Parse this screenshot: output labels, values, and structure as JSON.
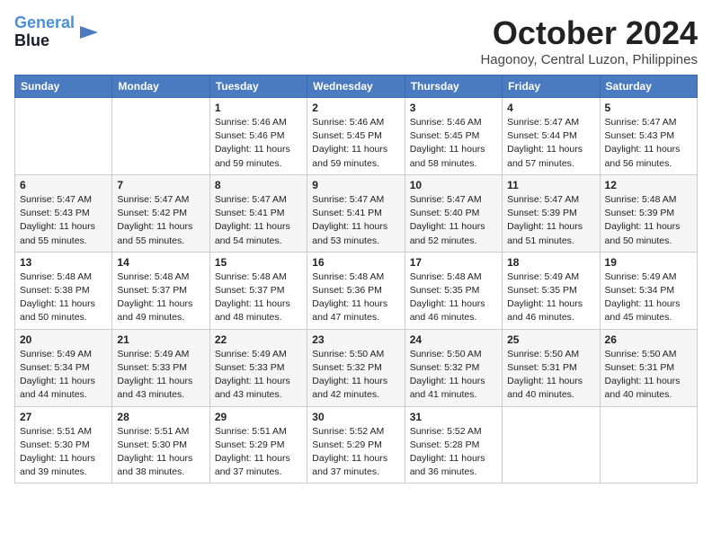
{
  "logo": {
    "line1": "General",
    "line2": "Blue",
    "icon": "▶"
  },
  "title": "October 2024",
  "location": "Hagonoy, Central Luzon, Philippines",
  "days_of_week": [
    "Sunday",
    "Monday",
    "Tuesday",
    "Wednesday",
    "Thursday",
    "Friday",
    "Saturday"
  ],
  "weeks": [
    [
      {
        "day": "",
        "info": ""
      },
      {
        "day": "",
        "info": ""
      },
      {
        "day": "1",
        "info": "Sunrise: 5:46 AM\nSunset: 5:46 PM\nDaylight: 11 hours\nand 59 minutes."
      },
      {
        "day": "2",
        "info": "Sunrise: 5:46 AM\nSunset: 5:45 PM\nDaylight: 11 hours\nand 59 minutes."
      },
      {
        "day": "3",
        "info": "Sunrise: 5:46 AM\nSunset: 5:45 PM\nDaylight: 11 hours\nand 58 minutes."
      },
      {
        "day": "4",
        "info": "Sunrise: 5:47 AM\nSunset: 5:44 PM\nDaylight: 11 hours\nand 57 minutes."
      },
      {
        "day": "5",
        "info": "Sunrise: 5:47 AM\nSunset: 5:43 PM\nDaylight: 11 hours\nand 56 minutes."
      }
    ],
    [
      {
        "day": "6",
        "info": "Sunrise: 5:47 AM\nSunset: 5:43 PM\nDaylight: 11 hours\nand 55 minutes."
      },
      {
        "day": "7",
        "info": "Sunrise: 5:47 AM\nSunset: 5:42 PM\nDaylight: 11 hours\nand 55 minutes."
      },
      {
        "day": "8",
        "info": "Sunrise: 5:47 AM\nSunset: 5:41 PM\nDaylight: 11 hours\nand 54 minutes."
      },
      {
        "day": "9",
        "info": "Sunrise: 5:47 AM\nSunset: 5:41 PM\nDaylight: 11 hours\nand 53 minutes."
      },
      {
        "day": "10",
        "info": "Sunrise: 5:47 AM\nSunset: 5:40 PM\nDaylight: 11 hours\nand 52 minutes."
      },
      {
        "day": "11",
        "info": "Sunrise: 5:47 AM\nSunset: 5:39 PM\nDaylight: 11 hours\nand 51 minutes."
      },
      {
        "day": "12",
        "info": "Sunrise: 5:48 AM\nSunset: 5:39 PM\nDaylight: 11 hours\nand 50 minutes."
      }
    ],
    [
      {
        "day": "13",
        "info": "Sunrise: 5:48 AM\nSunset: 5:38 PM\nDaylight: 11 hours\nand 50 minutes."
      },
      {
        "day": "14",
        "info": "Sunrise: 5:48 AM\nSunset: 5:37 PM\nDaylight: 11 hours\nand 49 minutes."
      },
      {
        "day": "15",
        "info": "Sunrise: 5:48 AM\nSunset: 5:37 PM\nDaylight: 11 hours\nand 48 minutes."
      },
      {
        "day": "16",
        "info": "Sunrise: 5:48 AM\nSunset: 5:36 PM\nDaylight: 11 hours\nand 47 minutes."
      },
      {
        "day": "17",
        "info": "Sunrise: 5:48 AM\nSunset: 5:35 PM\nDaylight: 11 hours\nand 46 minutes."
      },
      {
        "day": "18",
        "info": "Sunrise: 5:49 AM\nSunset: 5:35 PM\nDaylight: 11 hours\nand 46 minutes."
      },
      {
        "day": "19",
        "info": "Sunrise: 5:49 AM\nSunset: 5:34 PM\nDaylight: 11 hours\nand 45 minutes."
      }
    ],
    [
      {
        "day": "20",
        "info": "Sunrise: 5:49 AM\nSunset: 5:34 PM\nDaylight: 11 hours\nand 44 minutes."
      },
      {
        "day": "21",
        "info": "Sunrise: 5:49 AM\nSunset: 5:33 PM\nDaylight: 11 hours\nand 43 minutes."
      },
      {
        "day": "22",
        "info": "Sunrise: 5:49 AM\nSunset: 5:33 PM\nDaylight: 11 hours\nand 43 minutes."
      },
      {
        "day": "23",
        "info": "Sunrise: 5:50 AM\nSunset: 5:32 PM\nDaylight: 11 hours\nand 42 minutes."
      },
      {
        "day": "24",
        "info": "Sunrise: 5:50 AM\nSunset: 5:32 PM\nDaylight: 11 hours\nand 41 minutes."
      },
      {
        "day": "25",
        "info": "Sunrise: 5:50 AM\nSunset: 5:31 PM\nDaylight: 11 hours\nand 40 minutes."
      },
      {
        "day": "26",
        "info": "Sunrise: 5:50 AM\nSunset: 5:31 PM\nDaylight: 11 hours\nand 40 minutes."
      }
    ],
    [
      {
        "day": "27",
        "info": "Sunrise: 5:51 AM\nSunset: 5:30 PM\nDaylight: 11 hours\nand 39 minutes."
      },
      {
        "day": "28",
        "info": "Sunrise: 5:51 AM\nSunset: 5:30 PM\nDaylight: 11 hours\nand 38 minutes."
      },
      {
        "day": "29",
        "info": "Sunrise: 5:51 AM\nSunset: 5:29 PM\nDaylight: 11 hours\nand 37 minutes."
      },
      {
        "day": "30",
        "info": "Sunrise: 5:52 AM\nSunset: 5:29 PM\nDaylight: 11 hours\nand 37 minutes."
      },
      {
        "day": "31",
        "info": "Sunrise: 5:52 AM\nSunset: 5:28 PM\nDaylight: 11 hours\nand 36 minutes."
      },
      {
        "day": "",
        "info": ""
      },
      {
        "day": "",
        "info": ""
      }
    ]
  ]
}
